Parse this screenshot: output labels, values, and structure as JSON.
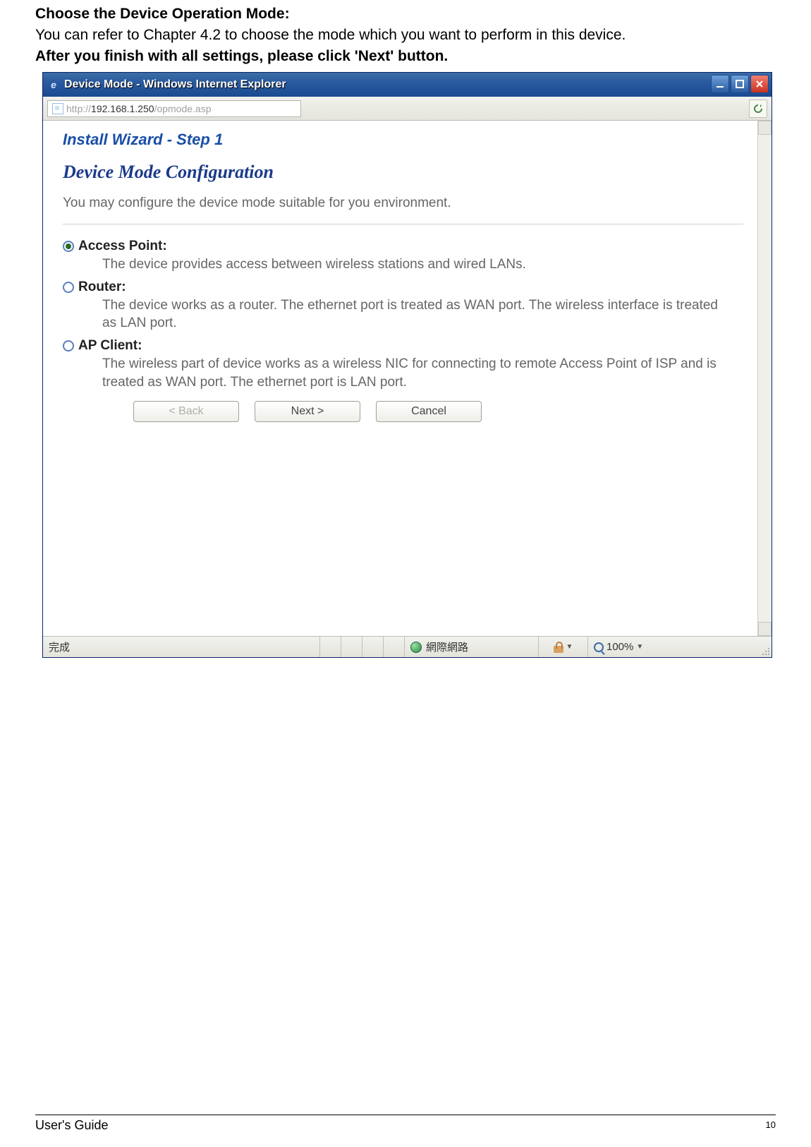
{
  "intro": {
    "heading": "Choose the Device Operation Mode:",
    "text": "You can refer to Chapter 4.2 to choose the mode which you want to perform in this device.",
    "heading2": "After you finish with all settings, please click 'Next' button."
  },
  "window": {
    "title": "Device Mode - Windows Internet Explorer",
    "url_prefix": "http://",
    "url_host": "192.168.1.250",
    "url_path": "/opmode.asp"
  },
  "page": {
    "step_title": "Install Wizard - Step 1",
    "config_title": "Device Mode Configuration",
    "config_desc": "You may configure the device mode suitable for you environment.",
    "options": [
      {
        "label": "Access Point:",
        "desc": "The device provides access between wireless stations and wired LANs.",
        "selected": true
      },
      {
        "label": "Router:",
        "desc": "The device works as a router. The ethernet port is treated as WAN port. The wireless interface is treated as LAN port.",
        "selected": false
      },
      {
        "label": "AP Client:",
        "desc": "The wireless part of device works as a wireless NIC for connecting to remote Access Point of ISP and is treated as WAN port. The ethernet port is LAN port.",
        "selected": false
      }
    ],
    "buttons": {
      "back": "< Back",
      "next": "Next >",
      "cancel": "Cancel"
    }
  },
  "statusbar": {
    "done": "完成",
    "zone": "網際網路",
    "zoom": "100%"
  },
  "footer": {
    "guide": "User's Guide",
    "page": "10"
  }
}
